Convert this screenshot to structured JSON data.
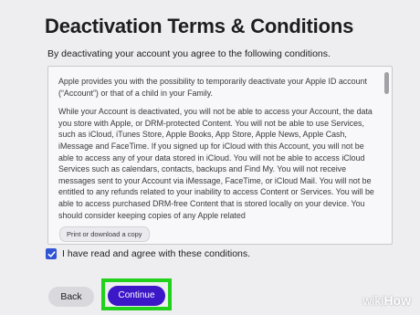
{
  "page": {
    "title": "Deactivation Terms & Conditions",
    "subtitle": "By deactivating your account you agree to the following conditions."
  },
  "terms": {
    "paragraphs": [
      "Apple provides you with the possibility to temporarily deactivate your Apple ID account (“Account”) or that of a child in your Family.",
      "While your Account is deactivated, you will not be able to access your Account, the data you store with Apple, or DRM-protected Content. You will not be able to use Services, such as iCloud, iTunes Store, Apple Books, App Store, Apple News, Apple Cash, iMessage and FaceTime. If you signed up for iCloud with this Account, you will not be able to access any of your data stored in iCloud. You will not be able to access iCloud Services such as calendars, contacts, backups and Find My. You will not receive messages sent to your Account via iMessage, FaceTime, or iCloud Mail. You will not be entitled to any refunds related to your inability to access Content or Services. You will be able to access purchased DRM-free Content that is stored locally on your device. You should consider keeping copies of any Apple related"
    ],
    "print_label": "Print or download a copy"
  },
  "agree": {
    "checked": true,
    "label": "I have read and agree with these conditions."
  },
  "actions": {
    "back_label": "Back",
    "continue_label": "Continue"
  },
  "colors": {
    "background": "#eeeef0",
    "accent": "#3b17c8",
    "checkbox": "#2f55d4",
    "highlight": "#22d11c"
  },
  "watermark": {
    "part1": "wiki",
    "part2": "How"
  }
}
